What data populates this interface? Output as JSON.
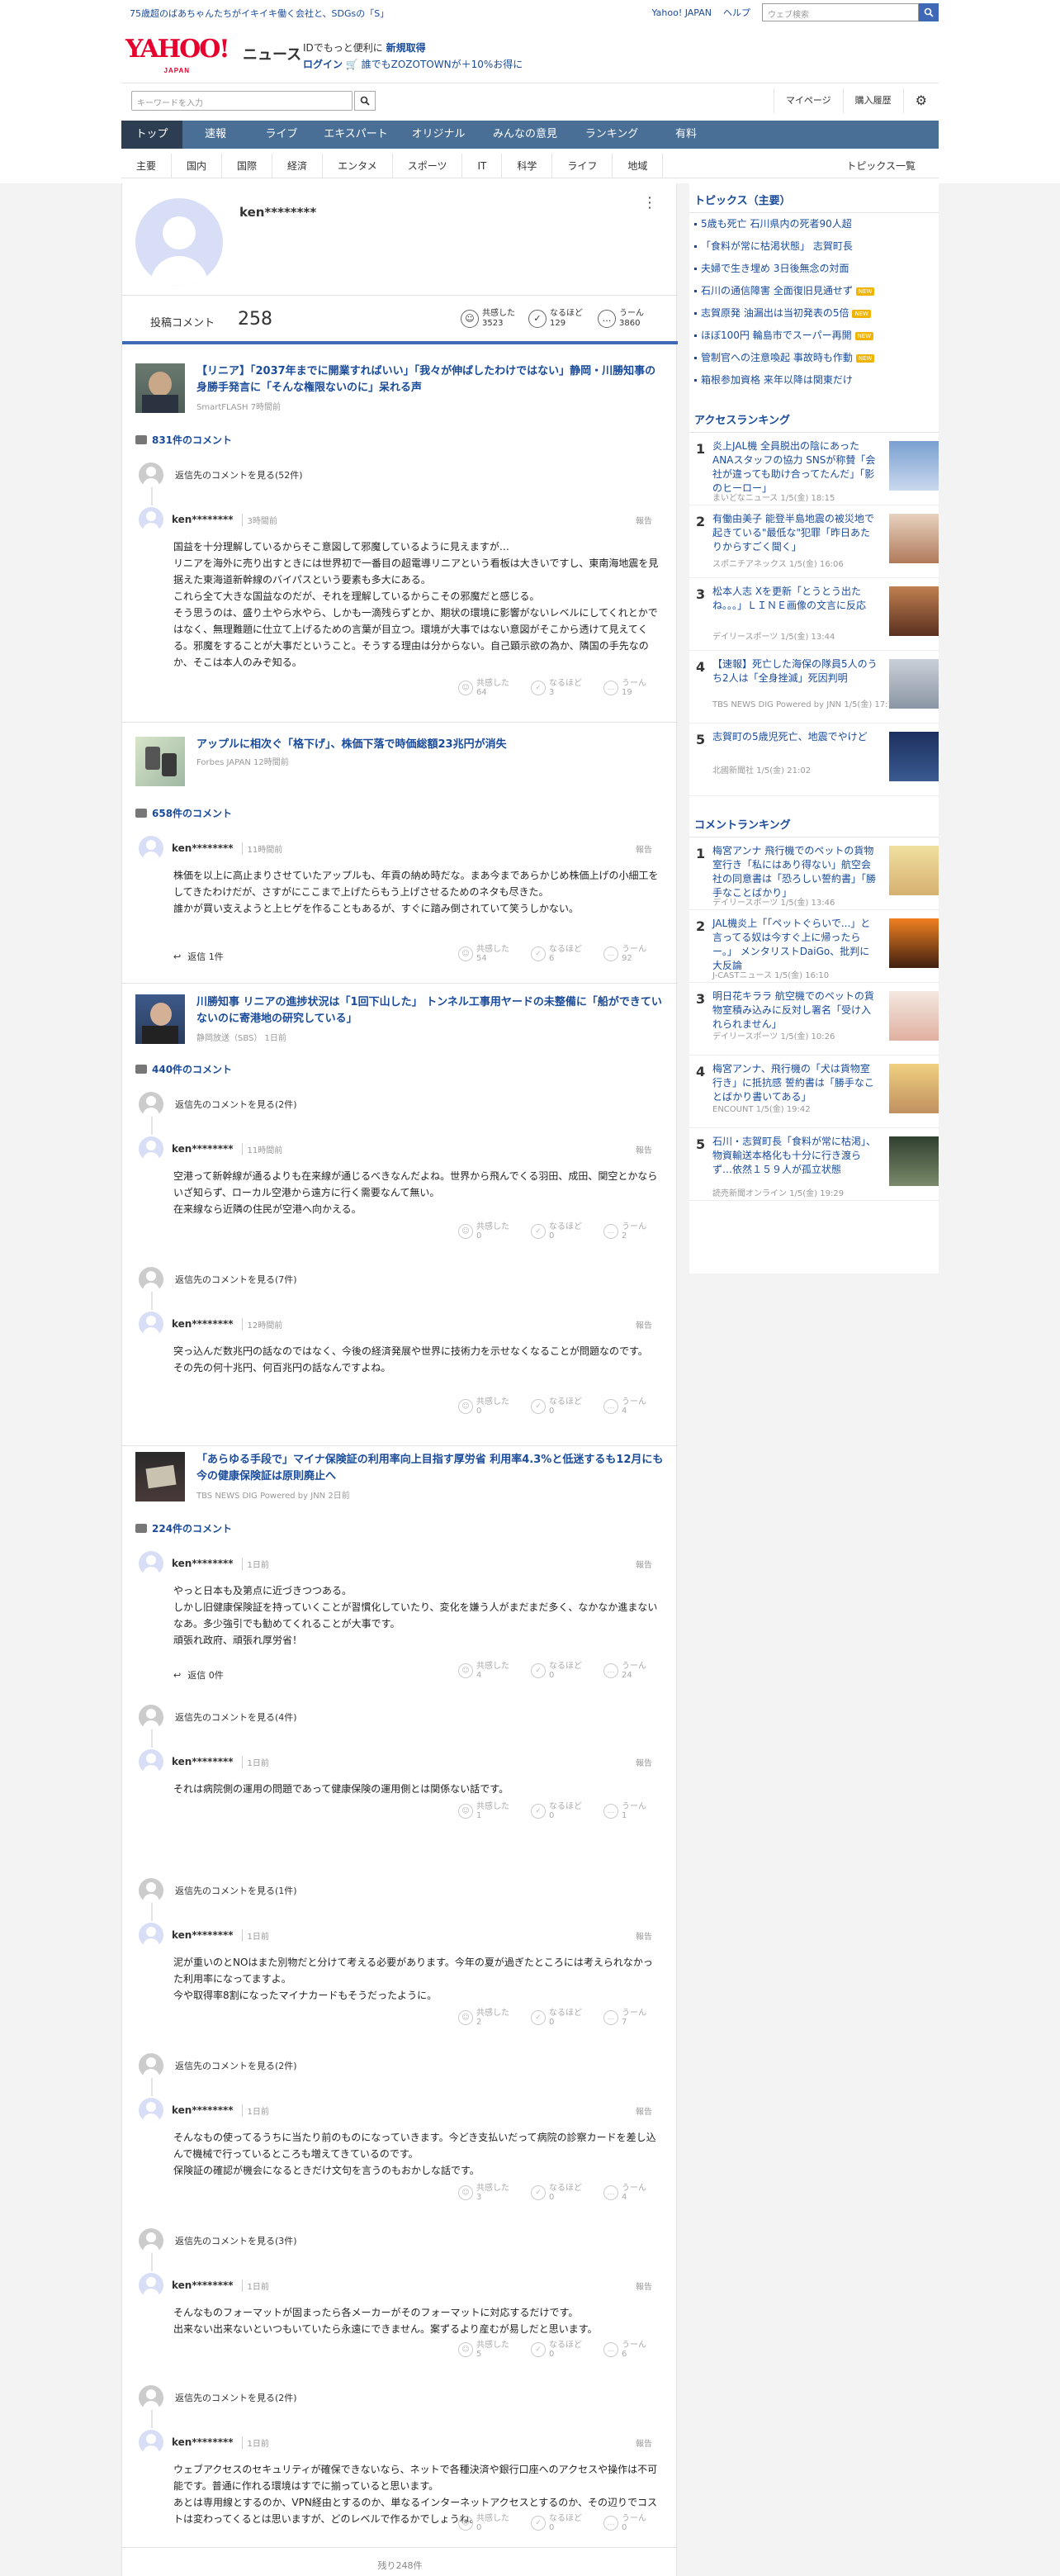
{
  "topbar": {
    "promo": "75歳超のばあちゃんたちがイキイキ働く会社と、SDGsの「S」",
    "links": [
      "Yahoo! JAPAN",
      "ヘルプ"
    ],
    "search_placeholder": "ウェブ検索"
  },
  "header": {
    "logo": "YAHOO!",
    "logo_sub": "JAPAN",
    "section": "ニュース",
    "promo1_prefix": "IDでもっと便利に",
    "promo1_link": "新規取得",
    "promo2_link": "ログイン",
    "promo2_text": "誰でもZOZOTOWNが＋10%お得に"
  },
  "searchbar": {
    "placeholder": "キーワードを入力",
    "mypage": "マイページ",
    "purchase": "購入履歴"
  },
  "nav_main": [
    "トップ",
    "速報",
    "ライブ",
    "エキスパート",
    "オリジナル",
    "みんなの意見",
    "ランキング",
    "有料"
  ],
  "nav_sub": [
    "主要",
    "国内",
    "国際",
    "経済",
    "エンタメ",
    "スポーツ",
    "IT",
    "科学",
    "ライフ",
    "地域"
  ],
  "nav_sub_more": "トピックス一覧",
  "profile": {
    "name": "ken********",
    "comments_label": "投稿コメント",
    "comments_count": "258",
    "stats": [
      {
        "label": "共感した",
        "value": "3523",
        "icon": "☺"
      },
      {
        "label": "なるほど",
        "value": "129",
        "icon": "✓"
      },
      {
        "label": "うーん",
        "value": "3860",
        "icon": "…"
      }
    ]
  },
  "vote_labels": [
    "共感した",
    "なるほど",
    "うーん"
  ],
  "articles": [
    {
      "title": "【リニア】「2037年までに開業すればいい」「我々が伸ばしたわけではない」静岡・川勝知事の身勝手発言に「そんな権限ないのに」呆れる声",
      "source": "SmartFLASH 7時間前",
      "comment_count": "831件のコメント"
    },
    {
      "title": "アップルに相次ぐ「格下げ」、株価下落で時価総額23兆円が消失",
      "source": "Forbes JAPAN 12時間前",
      "comment_count": "658件のコメント"
    },
    {
      "title": "川勝知事 リニアの進捗状況は「1回下山した」 トンネル工事用ヤードの未整備に「船ができていないのに寄港地の研究している」",
      "source": "静岡放送（SBS） 1日前",
      "comment_count": "440件のコメント"
    },
    {
      "title": "「あらゆる手段で」マイナ保険証の利用率向上目指す厚労省 利用率4.3%と低迷するも12月にも今の健康保険証は原則廃止へ",
      "source": "TBS NEWS DIG Powered by JNN 2日前",
      "comment_count": "224件のコメント"
    }
  ],
  "replies_links": [
    "返信先のコメントを見る(52件)",
    "返信先のコメントを見る(2件)",
    "返信先のコメントを見る(7件)",
    "返信先のコメントを見る(4件)",
    "返信先のコメントを見る(1件)",
    "返信先のコメントを見る(2件)",
    "返信先のコメントを見る(3件)",
    "返信先のコメントを見る(2件)"
  ],
  "report": "報告",
  "comments": [
    {
      "user": "ken********",
      "time": "3時間前",
      "body": "国益を十分理解しているからそこ意図して邪魔しているように見えますが…\nリニアを海外に売り出すときには世界初で一番目の超電導リニアという看板は大きいですし、東南海地震を見据えた東海道新幹線のバイパスという要素も多大にある。\nこれら全て大きな国益なのだが、それを理解しているからこその邪魔だと感じる。\nそう思うのは、盛り土やら水やら、しかも一滴残らずとか、期状の環境に影響がないレベルにしてくれとかではなく、無理難題に仕立て上げるための言葉が目立つ。環境が大事ではない意図がそこから透けて見えてくる。邪魔をすることが大事だということ。そうする理由は分からない。自己顕示欲の為か、隣国の手先なのか、そこは本人のみぞ知る。",
      "votes": [
        "64",
        "3",
        "19"
      ]
    },
    {
      "user": "ken********",
      "time": "11時間前",
      "body": "株価を以上に高止まりさせていたアップルも、年貢の納め時だな。まあ今まであらかじめ株価上げの小細工をしてきたわけだが、さすがにここまで上げたらもう上げさせるためのネタも尽きた。\n誰かが買い支えようと上ヒゲを作ることもあるが、すぐに踏み倒されていて笑うしかない。",
      "votes": [
        "54",
        "6",
        "92"
      ],
      "reply": "返信 1件"
    },
    {
      "user": "ken********",
      "time": "11時間前",
      "body": "空港って新幹線が通るよりも在来線が通じるべきなんだよね。世界から飛んでくる羽田、成田、関空とかならいざ知らず、ローカル空港から遠方に行く需要なんて無い。\n在来線なら近隣の住民が空港へ向かえる。",
      "votes": [
        "0",
        "0",
        "2"
      ]
    },
    {
      "user": "ken********",
      "time": "12時間前",
      "body": "突っ込んだ数兆円の話なのではなく、今後の経済発展や世界に技術力を示せなくなることが問題なのです。\nその先の何十兆円、何百兆円の話なんですよね。",
      "votes": [
        "0",
        "0",
        "4"
      ]
    },
    {
      "user": "ken********",
      "time": "1日前",
      "body": "やっと日本も及第点に近づきつつある。\nしかし旧健康保険証を持っていくことが習慣化していたり、変化を嫌う人がまだまだ多く、なかなか進まないなあ。多少強引でも勧めてくれることが大事です。\n頑張れ政府、頑張れ厚労省！",
      "votes": [
        "4",
        "0",
        "24"
      ],
      "reply": "返信 0件"
    },
    {
      "user": "ken********",
      "time": "1日前",
      "body": "それは病院側の運用の問題であって健康保険の運用側とは関係ない話です。",
      "votes": [
        "1",
        "0",
        "1"
      ]
    },
    {
      "user": "ken********",
      "time": "1日前",
      "body": "泥が重いのとNOはまた別物だと分けて考える必要があります。今年の夏が過ぎたところには考えられなかった利用率になってますよ。\n今や取得率8割になったマイナカードもそうだったように。",
      "votes": [
        "2",
        "0",
        "7"
      ]
    },
    {
      "user": "ken********",
      "time": "1日前",
      "body": "そんなもの使ってるうちに当たり前のものになっていきます。今どき支払いだって病院の診察カードを差し込んで機械で行っているところも増えてきているのです。\n保険証の確認が機会になるときだけ文句を言うのもおかしな話です。",
      "votes": [
        "3",
        "0",
        "4"
      ]
    },
    {
      "user": "ken********",
      "time": "1日前",
      "body": "そんなものフォーマットが固まったら各メーカーがそのフォーマットに対応するだけです。\n出来ない出来ないといつもいていたら永遠にできません。案ずるより産むが易しだと思います。",
      "votes": [
        "5",
        "0",
        "6"
      ]
    },
    {
      "user": "ken********",
      "time": "1日前",
      "body": "ウェブアクセスのセキュリティが確保できないなら、ネットで各種決済や銀行口座へのアクセスや操作は不可能です。普通に作れる環境はすでに揃っていると思います。\nあとは専用線とするのか、VPN経由とするのか、単なるインターネットアクセスとするのか、その辺りでコストは変わってくるとは思いますが、どのレベルで作るかでしょうね。",
      "votes": [
        "0",
        "0",
        "0"
      ]
    }
  ],
  "more_bottom": "残り248件",
  "side": {
    "topics_title": "トピックス（主要）",
    "topics": [
      {
        "t": "5歳も死亡 石川県内の死者90人超",
        "new": false
      },
      {
        "t": "「食料が常に枯渇状態」 志賀町長",
        "new": false
      },
      {
        "t": "夫婦で生き埋め 3日後無念の対面",
        "new": false
      },
      {
        "t": "石川の通信障害 全面復旧見通せず",
        "new": true
      },
      {
        "t": "志賀原発 油漏出は当初発表の5倍",
        "new": true
      },
      {
        "t": "ほぼ100円 輪島市でスーパー再開",
        "new": true
      },
      {
        "t": "管制官への注意喚起 事故時も作動",
        "new": true
      },
      {
        "t": "箱根参加資格 来年以降は関東だけ",
        "new": false
      }
    ],
    "new_label": "NEW",
    "access_title": "アクセスランキング",
    "access": [
      {
        "n": "1",
        "t": "炎上JAL機 全員脱出の陰にあったANAスタッフの協力 SNSが称賛「会社が違っても助け合ってたんだ」「影のヒーロー」",
        "s": "まいどなニュース 1/5(金) 18:15"
      },
      {
        "n": "2",
        "t": "有働由美子 能登半島地震の被災地で起きている\"最低な\"犯罪「昨日あたりからすごく聞く」",
        "s": "スポニチアネックス 1/5(金) 16:06"
      },
      {
        "n": "3",
        "t": "松本人志 Xを更新「とうとう出たね。。。」ＬＩＮＥ画像の文言に反応",
        "s": "デイリースポーツ 1/5(金) 13:44"
      },
      {
        "n": "4",
        "t": "【速報】死亡した海保の隊員5人のうち2人は「全身挫滅」死因判明",
        "s": "TBS NEWS DIG Powered by JNN 1/5(金) 17:19"
      },
      {
        "n": "5",
        "t": "志賀町の5歳児死亡、地震でやけど",
        "s": "北國新聞社 1/5(金) 21:02"
      }
    ],
    "comment_title": "コメントランキング",
    "commentrank": [
      {
        "n": "1",
        "t": "梅宮アンナ 飛行機でのペットの貨物室行き「私にはあり得ない」航空会社の同意書は「恐ろしい誓約書」「勝手なことばかり」",
        "s": "デイリースポーツ 1/5(金) 13:46"
      },
      {
        "n": "2",
        "t": "JAL機炎上「「ペットぐらいで...」と言ってる奴は今すぐ上に帰ったらー。」 メンタリストDaiGo、批判に大反論",
        "s": "J-CASTニュース 1/5(金) 16:10"
      },
      {
        "n": "3",
        "t": "明日花キララ 航空機でのペットの貨物室積み込みに反対し署名「受け入れられません」",
        "s": "デイリースポーツ 1/5(金) 10:26"
      },
      {
        "n": "4",
        "t": "梅宮アンナ、飛行機の「犬は貨物室行き」に抵抗感 誓約書は「勝手なことばかり書いてある」",
        "s": "ENCOUNT 1/5(金) 19:42"
      },
      {
        "n": "5",
        "t": "石川・志賀町長「食料が常に枯渇」、物資輸送本格化も十分に行き渡らず…依然１５９人が孤立状態",
        "s": "読売新聞オンライン 1/5(金) 19:29"
      }
    ]
  }
}
